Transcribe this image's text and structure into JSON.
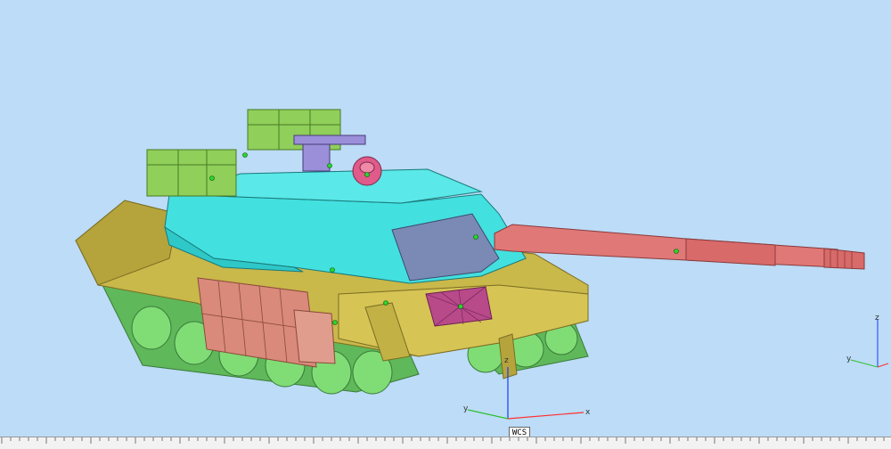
{
  "viewport": {
    "background": "#bcdcf7",
    "model": "tank-model",
    "colors": {
      "hull": "#c9b84a",
      "turret": "#43e0e0",
      "gun_barrel": "#e07878",
      "wheels": "#74d86a",
      "ammo_boxes": "#8fcf5a",
      "side_armor": "#d98a7a",
      "hatch_dome": "#e05a8a",
      "machine_gun": "#9a8fd8"
    }
  },
  "triad_main": {
    "label": "WCS",
    "x_label": "x",
    "y_label": "y",
    "z_label": "z"
  },
  "triad_corner": {
    "x_label": "x",
    "y_label": "y",
    "z_label": "z"
  }
}
